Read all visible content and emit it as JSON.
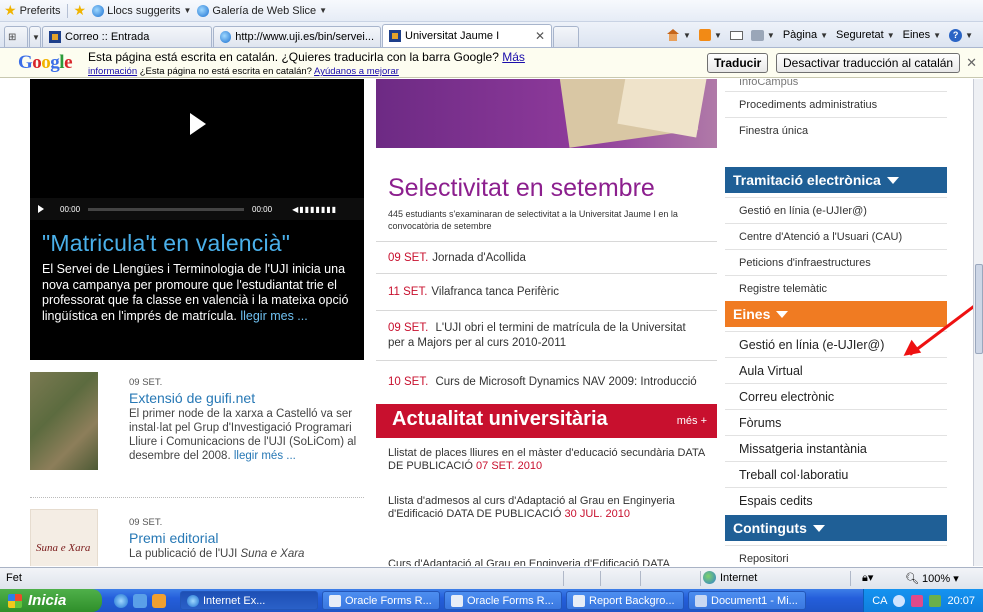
{
  "favorites_bar": {
    "favorites_label": "Preferits",
    "suggested_sites_label": "Llocs suggerits",
    "web_slice_label": "Galería de Web Slice"
  },
  "tabs": [
    {
      "label": "Correo :: Entrada"
    },
    {
      "label": "http://www.uji.es/bin/servei..."
    },
    {
      "label": "Universitat Jaume I"
    }
  ],
  "command_bar": {
    "page_label": "Pàgina",
    "safety_label": "Seguretat",
    "tools_label": "Eines"
  },
  "google_bar": {
    "logo": "Google",
    "message": "Esta página está escrita en catalán. ¿Quieres traducirla con la barra Google?",
    "more_info_a": "Más",
    "more_info_b": "información",
    "not_catalan": "¿Esta página no está escrita en catalán?",
    "help_improve": "Ayúdanos a mejorar",
    "translate_button": "Traducir",
    "deactivate_button": "Desactivar traducción al catalán"
  },
  "video": {
    "time_left": "00:00",
    "time_right": "00:00"
  },
  "feature": {
    "title": "\"Matricula't en valencià\"",
    "body": "El Servei de Llengües i Terminologia de l'UJI inicia una nova campanya per promoure que l'estudiantat trie el professorat que fa classe en valencià i la mateixa opció lingüística en l'imprés de matrícula.",
    "more": "llegir mes ..."
  },
  "news": [
    {
      "date": "09 SET.",
      "title": "Extensió de guifi.net",
      "text": "El primer node de la xarxa a Castelló va ser instal·lat pel Grup d'Investigació Programari Lliure i Comunicacions de l'UJI (SoLiCom) al desembre del 2008.",
      "more": "llegir més ..."
    },
    {
      "date": "09 SET.",
      "title": "Premi editorial",
      "text_pre": "La publicació de l'UJI",
      "text_em": "Suna e Xara",
      "thumb_caption": "Suna e Xara"
    }
  ],
  "middle": {
    "headline": "Selectivitat en setembre",
    "subline": "445 estudiants s'examinaran de selectivitat a la Universitat Jaume I en la convocatòria de setembre",
    "items": [
      {
        "date": "09 SET.",
        "text": "Jornada d'Acollida"
      },
      {
        "date": "11 SET.",
        "text": "Vilafranca tanca Perifèric"
      },
      {
        "date": "09 SET.",
        "text": "L'UJI obri el termini de matrícula de la Universitat per a Majors per al curs 2010-2011"
      },
      {
        "date": "10 SET.",
        "text": "Curs de Microsoft Dynamics NAV 2009: Introducció"
      }
    ],
    "actualitat_title": "Actualitat universitària",
    "actualitat_more": "més +",
    "actualitat_items": [
      {
        "text": "Llistat de places lliures en el màster d'educació secundària DATA DE PUBLICACIÓ",
        "date": "07 SET. 2010"
      },
      {
        "text": "Llista d'admesos al curs d'Adaptació al Grau en Enginyeria d'Edificació DATA DE PUBLICACIÓ",
        "date": "30 JUL. 2010"
      },
      {
        "text": "Curs d'Adaptació al Grau en Enginyeria d'Edificació DATA"
      }
    ]
  },
  "right": {
    "top_partial": "InfoCampus",
    "top_links": [
      "Procediments administratius",
      "Finestra única"
    ],
    "tramitacio_title": "Tramitació electrònica",
    "tramitacio_links": [
      "Gestió en línia (e-UJIer@)",
      "Centre d'Atenció a l'Usuari (CAU)",
      "Peticions d'infraestructures",
      "Registre telemàtic"
    ],
    "eines_title": "Eines",
    "eines_links": [
      "Gestió en línia (e-UJIer@)",
      "Aula Virtual",
      "Correu electrònic",
      "Fòrums",
      "Missatgeria instantània",
      "Treball col·laboratiu",
      "Espais cedits"
    ],
    "continguts_title": "Continguts",
    "continguts_links": [
      "Repositori"
    ]
  },
  "status_bar": {
    "status": "Fet",
    "zone": "Internet",
    "zoom": "100%"
  },
  "taskbar": {
    "start": "Inicia",
    "tasks": [
      "Internet Ex...",
      "Oracle Forms R...",
      "Oracle Forms R...",
      "Report Backgro...",
      "Document1 - Mi..."
    ],
    "lang": "CA",
    "clock": "20:07"
  },
  "colors": {
    "feature_title": "#4ab0ea",
    "headline_purple": "#8c1f8e",
    "accent_red": "#c8102e",
    "right_header_blue": "#1f5f96",
    "right_header_orange": "#f07b22",
    "link_blue": "#2778b5",
    "annotation_arrow": "#ee1111"
  }
}
